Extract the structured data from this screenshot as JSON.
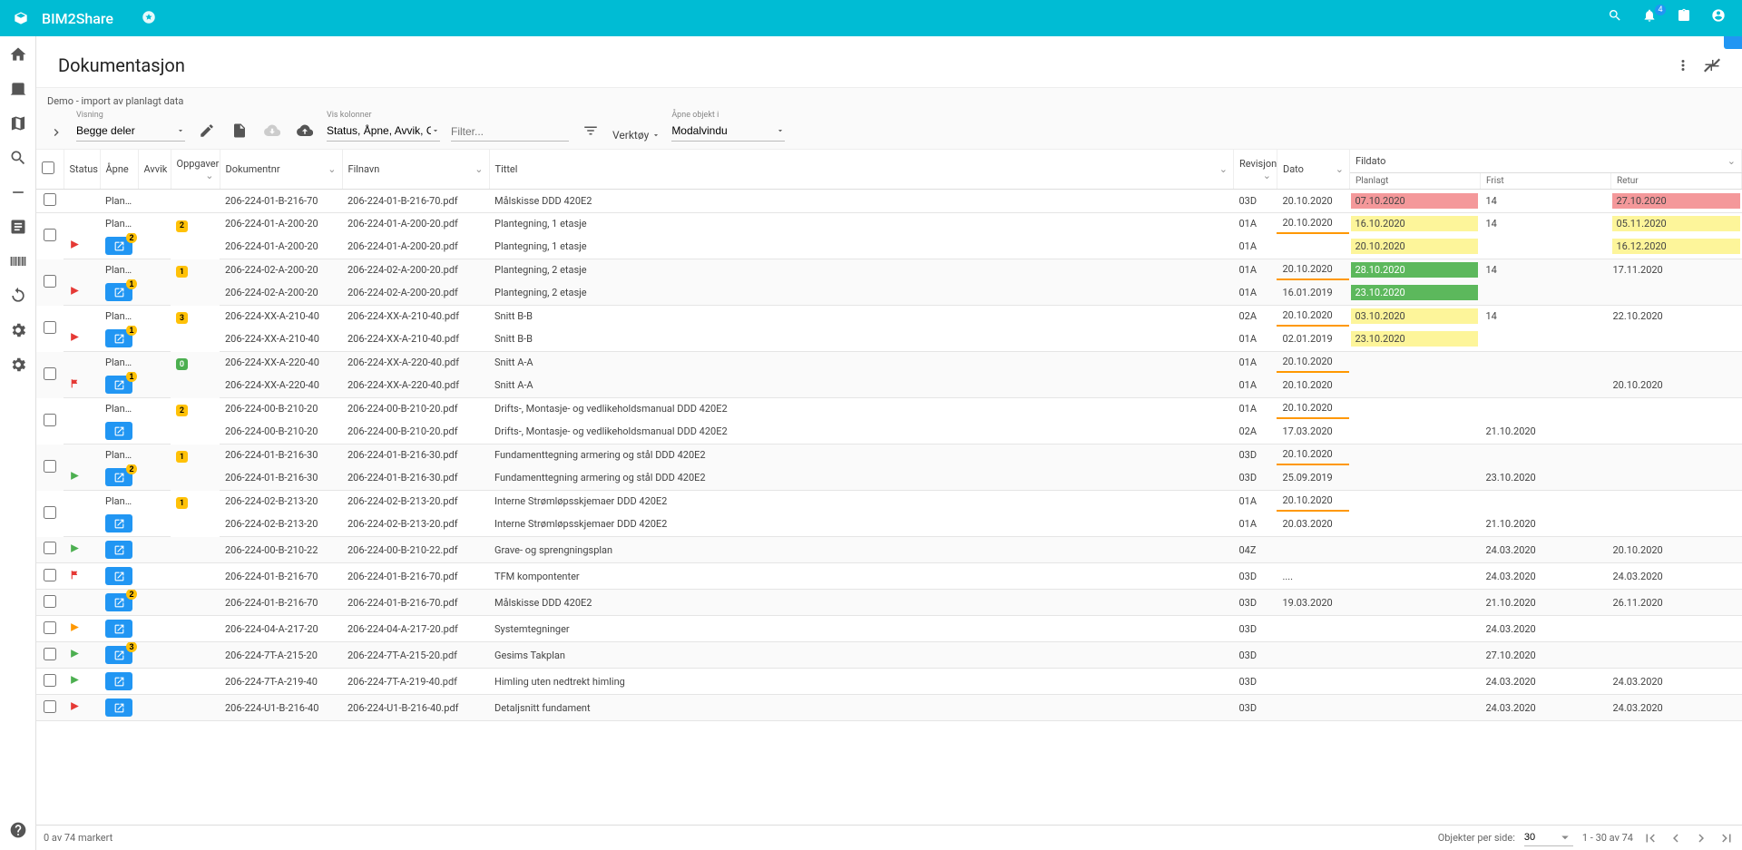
{
  "topbar": {
    "title": "BIM2Share",
    "notif_count": "4"
  },
  "page": {
    "title": "Dokumentasjon",
    "subtitle": "Demo - import av planlagt data"
  },
  "toolbar": {
    "visning_label": "Visning",
    "visning_value": "Begge deler",
    "viskol_label": "Vis kolonner",
    "viskol_value": "Status, Åpne, Avvik, Opp...",
    "filter_placeholder": "Filter...",
    "verktoy_label": "Verktøy",
    "apne_label": "Åpne objekt i",
    "apne_value": "Modalvindu"
  },
  "headers": {
    "status": "Status",
    "apne": "Åpne",
    "avvik": "Avvik",
    "oppgaver": "Oppgaver",
    "docnr": "Dokumentnr",
    "filnavn": "Filnavn",
    "tittel": "Tittel",
    "revisjon": "Revisjon",
    "dato": "Dato",
    "fildato": "Fildato",
    "planlagt": "Planlagt",
    "frist": "Frist",
    "retur": "Retur"
  },
  "rows": [
    {
      "odd": false,
      "children": [
        {
          "planned": true,
          "status": "Planlagt",
          "doc": "206-224-01-B-216-70",
          "fil": "206-224-01-B-216-70.pdf",
          "tittel": "Målskisse DDD 420E2",
          "rev": "03D",
          "dato": "20.10.2020",
          "plan": "07.10.2020",
          "planC": "red",
          "frist": "14",
          "retur": "27.10.2020",
          "returC": "red"
        }
      ]
    },
    {
      "odd": false,
      "children": [
        {
          "planned": true,
          "status": "Planlagt",
          "task": "2",
          "taskC": "y",
          "doc": "206-224-01-A-200-20",
          "fil": "206-224-01-A-200-20.pdf",
          "tittel": "Plantegning, 1 etasje",
          "rev": "01A",
          "dato": "20.10.2020",
          "datoU": true,
          "plan": "16.10.2020",
          "planC": "yellow",
          "frist": "14",
          "retur": "05.11.2020",
          "returC": "yellow"
        },
        {
          "flag": "red-right",
          "open": true,
          "openN": "2",
          "doc": "206-224-01-A-200-20",
          "fil": "206-224-01-A-200-20.pdf",
          "tittel": "Plantegning, 1 etasje",
          "rev": "01A",
          "dato": "",
          "plan": "20.10.2020",
          "planC": "yellow",
          "frist": "",
          "retur": "16.12.2020",
          "returC": "yellow"
        }
      ]
    },
    {
      "odd": true,
      "children": [
        {
          "planned": true,
          "status": "Planlagt",
          "task": "1",
          "taskC": "y",
          "doc": "206-224-02-A-200-20",
          "fil": "206-224-02-A-200-20.pdf",
          "tittel": "Plantegning, 2 etasje",
          "rev": "01A",
          "dato": "20.10.2020",
          "datoU": true,
          "plan": "28.10.2020",
          "planC": "green",
          "frist": "14",
          "retur": "17.11.2020"
        },
        {
          "flag": "red-right",
          "open": true,
          "openN": "1",
          "doc": "206-224-02-A-200-20",
          "fil": "206-224-02-A-200-20.pdf",
          "tittel": "Plantegning, 2 etasje",
          "rev": "01A",
          "dato": "16.01.2019",
          "plan": "23.10.2020",
          "planC": "green",
          "frist": "",
          "retur": ""
        }
      ]
    },
    {
      "odd": false,
      "children": [
        {
          "planned": true,
          "status": "Planlagt",
          "task": "3",
          "taskC": "y",
          "doc": "206-224-XX-A-210-40",
          "fil": "206-224-XX-A-210-40.pdf",
          "tittel": "Snitt B-B",
          "rev": "02A",
          "dato": "20.10.2020",
          "datoU": true,
          "plan": "03.10.2020",
          "planC": "yellow",
          "frist": "14",
          "retur": "22.10.2020"
        },
        {
          "flag": "red-right",
          "open": true,
          "openN": "1",
          "doc": "206-224-XX-A-210-40",
          "fil": "206-224-XX-A-210-40.pdf",
          "tittel": "Snitt B-B",
          "rev": "01A",
          "dato": "02.01.2019",
          "plan": "23.10.2020",
          "planC": "yellow",
          "frist": "",
          "retur": ""
        }
      ]
    },
    {
      "odd": true,
      "children": [
        {
          "planned": true,
          "status": "Planlagt",
          "task": "0",
          "taskC": "g",
          "doc": "206-224-XX-A-220-40",
          "fil": "206-224-XX-A-220-40.pdf",
          "tittel": "Snitt A-A",
          "rev": "01A",
          "dato": "20.10.2020",
          "datoU": true,
          "plan": "",
          "frist": "",
          "retur": ""
        },
        {
          "flag": "red-flag",
          "open": true,
          "openN": "1",
          "doc": "206-224-XX-A-220-40",
          "fil": "206-224-XX-A-220-40.pdf",
          "tittel": "Snitt A-A",
          "rev": "01A",
          "dato": "20.10.2020",
          "plan": "",
          "frist": "",
          "retur": "20.10.2020"
        }
      ]
    },
    {
      "odd": false,
      "children": [
        {
          "planned": true,
          "status": "Planlagt",
          "task": "2",
          "taskC": "y",
          "doc": "206-224-00-B-210-20",
          "fil": "206-224-00-B-210-20.pdf",
          "tittel": "Drifts-, Montasje- og vedlikeholdsmanual DDD 420E2",
          "rev": "01A",
          "dato": "20.10.2020",
          "datoU": true,
          "plan": "",
          "frist": "",
          "retur": ""
        },
        {
          "open": true,
          "doc": "206-224-00-B-210-20",
          "fil": "206-224-00-B-210-20.pdf",
          "tittel": "Drifts-, Montasje- og vedlikeholdsmanual DDD 420E2",
          "rev": "02A",
          "dato": "17.03.2020",
          "plan": "",
          "frist": "21.10.2020",
          "retur": ""
        }
      ]
    },
    {
      "odd": true,
      "children": [
        {
          "planned": true,
          "status": "Planlagt",
          "task": "1",
          "taskC": "y",
          "doc": "206-224-01-B-216-30",
          "fil": "206-224-01-B-216-30.pdf",
          "tittel": "Fundamenttegning armering og stål DDD 420E2",
          "rev": "03D",
          "dato": "20.10.2020",
          "datoU": true,
          "plan": "",
          "frist": "",
          "retur": ""
        },
        {
          "flag": "green-right",
          "open": true,
          "openN": "2",
          "doc": "206-224-01-B-216-30",
          "fil": "206-224-01-B-216-30.pdf",
          "tittel": "Fundamenttegning armering og stål DDD 420E2",
          "rev": "03D",
          "dato": "25.09.2019",
          "plan": "",
          "frist": "23.10.2020",
          "retur": ""
        }
      ]
    },
    {
      "odd": false,
      "children": [
        {
          "planned": true,
          "status": "Planlagt",
          "task": "1",
          "taskC": "y",
          "doc": "206-224-02-B-213-20",
          "fil": "206-224-02-B-213-20.pdf",
          "tittel": "Interne Strømløpsskjemaer DDD 420E2",
          "rev": "01A",
          "dato": "20.10.2020",
          "datoU": true,
          "plan": "",
          "frist": "",
          "retur": ""
        },
        {
          "open": true,
          "doc": "206-224-02-B-213-20",
          "fil": "206-224-02-B-213-20.pdf",
          "tittel": "Interne Strømløpsskjemaer DDD 420E2",
          "rev": "01A",
          "dato": "20.03.2020",
          "plan": "",
          "frist": "21.10.2020",
          "retur": ""
        }
      ]
    },
    {
      "odd": true,
      "children": [
        {
          "flag": "green-right",
          "open": true,
          "doc": "206-224-00-B-210-22",
          "fil": "206-224-00-B-210-22.pdf",
          "tittel": "Grave- og sprengningsplan",
          "rev": "04Z",
          "dato": "",
          "plan": "",
          "frist": "24.03.2020",
          "retur": "20.10.2020"
        }
      ]
    },
    {
      "odd": false,
      "children": [
        {
          "flag": "red-flag",
          "open": true,
          "doc": "206-224-01-B-216-70",
          "fil": "206-224-01-B-216-70.pdf",
          "tittel": "TFM kompontenter",
          "rev": "03D",
          "dato": "....",
          "plan": "",
          "frist": "24.03.2020",
          "retur": "24.03.2020"
        }
      ]
    },
    {
      "odd": true,
      "children": [
        {
          "open": true,
          "openN": "2",
          "doc": "206-224-01-B-216-70",
          "fil": "206-224-01-B-216-70.pdf",
          "tittel": "Målskisse DDD 420E2",
          "rev": "03D",
          "dato": "19.03.2020",
          "plan": "",
          "frist": "21.10.2020",
          "retur": "26.11.2020"
        }
      ]
    },
    {
      "odd": false,
      "children": [
        {
          "flag": "orange-right",
          "open": true,
          "doc": "206-224-04-A-217-20",
          "fil": "206-224-04-A-217-20.pdf",
          "tittel": "Systemtegninger",
          "rev": "03D",
          "dato": "",
          "plan": "",
          "frist": "24.03.2020",
          "retur": ""
        }
      ]
    },
    {
      "odd": true,
      "children": [
        {
          "flag": "green-right",
          "open": true,
          "openN": "3",
          "doc": "206-224-7T-A-215-20",
          "fil": "206-224-7T-A-215-20.pdf",
          "tittel": "Gesims Takplan",
          "rev": "03D",
          "dato": "",
          "plan": "",
          "frist": "27.10.2020",
          "retur": ""
        }
      ]
    },
    {
      "odd": false,
      "children": [
        {
          "flag": "green-right",
          "open": true,
          "doc": "206-224-7T-A-219-40",
          "fil": "206-224-7T-A-219-40.pdf",
          "tittel": "Himling uten nedtrekt himling",
          "rev": "03D",
          "dato": "",
          "plan": "",
          "frist": "24.03.2020",
          "retur": "24.03.2020"
        }
      ]
    },
    {
      "odd": true,
      "children": [
        {
          "flag": "red-right",
          "open": true,
          "doc": "206-224-U1-B-216-40",
          "fil": "206-224-U1-B-216-40.pdf",
          "tittel": "Detaljsnitt fundament",
          "rev": "03D",
          "dato": "",
          "plan": "",
          "frist": "24.03.2020",
          "retur": "24.03.2020"
        }
      ]
    }
  ],
  "footer": {
    "selected": "0 av 74 markert",
    "perpage_label": "Objekter per side:",
    "perpage_value": "30",
    "range": "1 - 30 av 74"
  }
}
